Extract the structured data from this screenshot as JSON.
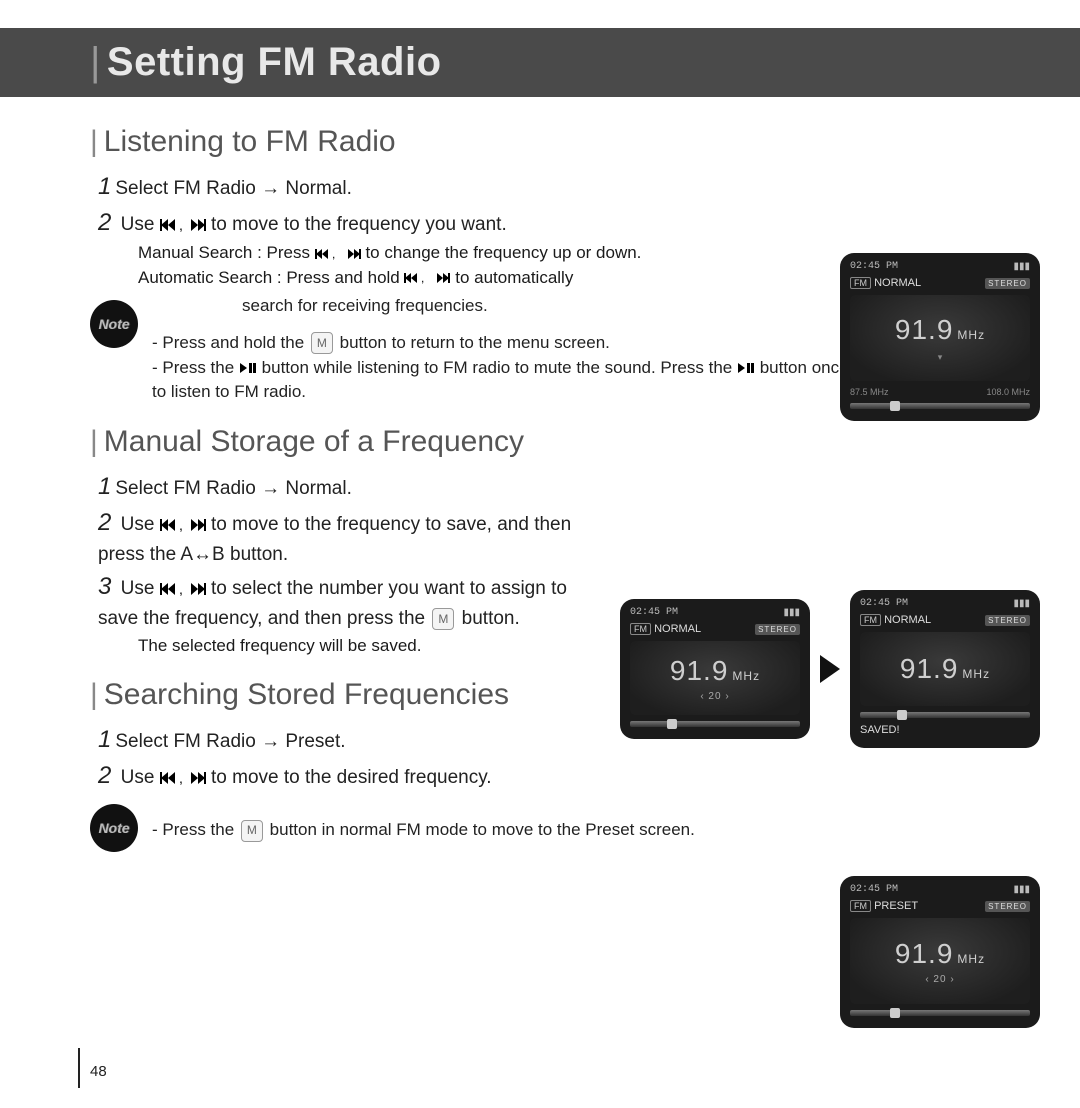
{
  "title": "Setting FM Radio",
  "page_number": "48",
  "sections": {
    "s1": {
      "heading": "Listening to FM Radio",
      "step1": "Select FM Radio → Normal.",
      "step2a": "Use ",
      "step2b": " to move to the frequency you want.",
      "sub1a": "Manual Search :  Press ",
      "sub1b": " to change the frequency up or down.",
      "sub2a": "Automatic Search :  Press and hold ",
      "sub2b": " to automatically",
      "sub3": "search for receiving frequencies.",
      "note1a": "- Press and hold the ",
      "note1b": " button to return to the menu screen.",
      "note2a": "- Press the ",
      "note2b": " button while listening to FM radio to mute the sound. Press the ",
      "note2c": " button once again to listen to FM radio."
    },
    "s2": {
      "heading": "Manual Storage of a Frequency",
      "step1": "Select FM Radio → Normal.",
      "step2a": "Use ",
      "step2b": " to move to the frequency to save, and then press the A↔B button.",
      "step3a": "Use ",
      "step3b": " to select the number you want to assign to save the frequency, and then press the ",
      "step3c": " button.",
      "sub": "The selected frequency will be saved."
    },
    "s3": {
      "heading": "Searching Stored Frequencies",
      "step1": "Select FM Radio → Preset.",
      "step2a": "Use ",
      "step2b": " to move to the desired frequency.",
      "note1a": "- Press the ",
      "note1b": " button in normal FM mode to move to the Preset screen."
    }
  },
  "note_label": "Note",
  "device": {
    "time": "02:45 PM",
    "mode_normal": "NORMAL",
    "mode_preset": "PRESET",
    "stereo": "STEREO",
    "freq": "91.9",
    "unit": "MHz",
    "range_low": "87.5 MHz",
    "range_high": "108.0 MHz",
    "preset_num": "‹ 20 ›",
    "saved": "SAVED!",
    "fm_label": "FM"
  }
}
